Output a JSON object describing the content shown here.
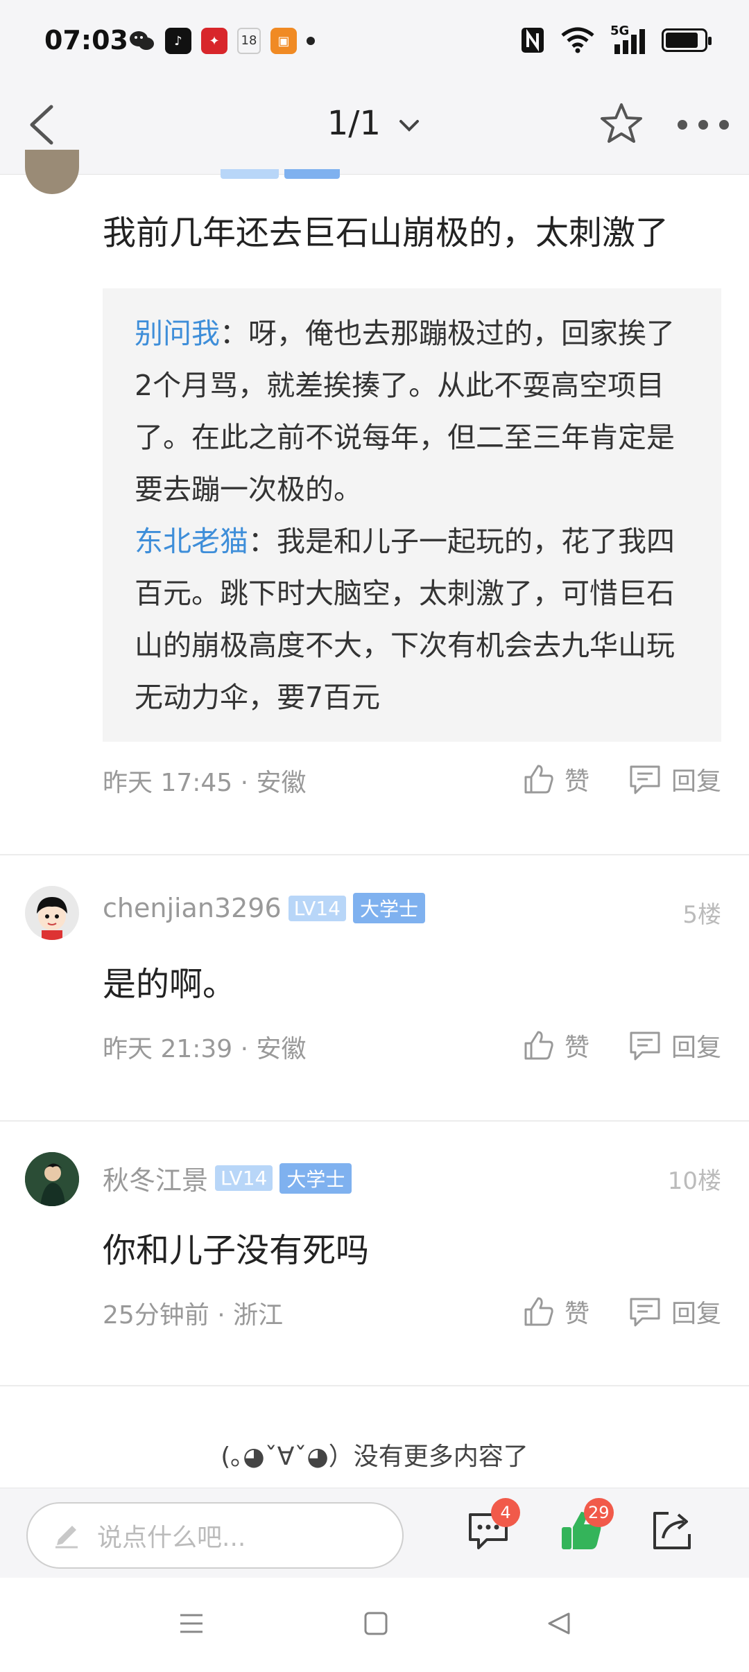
{
  "status_bar": {
    "time": "07:03",
    "icons_left": [
      "wechat-icon",
      "tiktok-icon",
      "app-red-icon",
      "calendar-icon",
      "app-orange-icon",
      "dot-icon"
    ],
    "icons_right": [
      "nfc-icon",
      "wifi-icon",
      "signal-5g-icon",
      "battery-icon"
    ],
    "calendar_day": "18",
    "network": "5G"
  },
  "nav": {
    "page_indicator": "1/1"
  },
  "thread": {
    "top_comment": {
      "text": "我前几年还去巨石山崩极的，太刺激了",
      "replies": [
        {
          "name": "别问我",
          "sep": "：",
          "text": "呀，俺也去那蹦极过的，回家挨了2个月骂，就差挨揍了。从此不耍高空项目了。在此之前不说每年，但二至三年肯定是要去蹦一次极的。"
        },
        {
          "name": "东北老猫",
          "sep": "：",
          "text": "我是和儿子一起玩的，花了我四百元。跳下时大脑空，太刺激了，可惜巨石山的崩极高度不大，下次有机会去九华山玩无动力伞，要7百元"
        }
      ],
      "meta": "昨天 17:45 · 安徽"
    },
    "comments": [
      {
        "username": "chenjian3296",
        "level": "LV14",
        "rank": "大学士",
        "floor": "5楼",
        "text": "是的啊。",
        "meta": "昨天 21:39 · 安徽"
      },
      {
        "username": "秋冬江景",
        "level": "LV14",
        "rank": "大学士",
        "floor": "10楼",
        "text": "你和儿子没有死吗",
        "meta": "25分钟前 · 浙江"
      }
    ],
    "like_label": "赞",
    "reply_label": "回复",
    "no_more": "(｡◕ˇ∀ˇ◕）没有更多内容了"
  },
  "bottom_bar": {
    "input_placeholder": "说点什么吧...",
    "comment_count": "4",
    "like_count": "29"
  },
  "colors": {
    "link_blue": "#3e8ed9",
    "like_green": "#34b45a",
    "badge_red": "#f15a4a"
  }
}
